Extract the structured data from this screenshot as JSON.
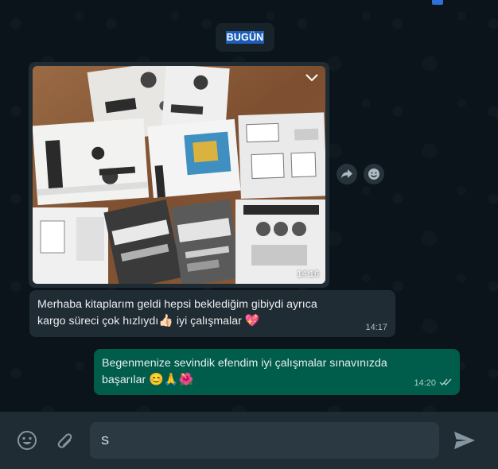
{
  "date_chip": "BUGÜN",
  "messages": [
    {
      "kind": "image",
      "direction": "incoming",
      "time": "14:16"
    },
    {
      "kind": "text",
      "direction": "incoming",
      "line1": "Merhaba kitaplarım geldi hepsi beklediğim gibiydi ayrıca",
      "line2_text": "kargo süreci çok hızlıydı",
      "line2_emoji": "👍🏻",
      "line2_after": " iyi çalışmalar ",
      "line2_emoji2": "💖",
      "time": "14:17"
    },
    {
      "kind": "text",
      "direction": "outgoing",
      "line1": "Begenmenize sevindik efendim iyi çalışmalar sınavınızda",
      "line2_text": "başarılar ",
      "line2_emoji": "😊🙏🌺",
      "time": "14:20",
      "status_icon": "double-check-icon"
    }
  ],
  "composer": {
    "value": "S"
  },
  "icons": {
    "image_menu": "chevron-down-icon",
    "forward": "forward-icon",
    "react": "emoji-react-icon",
    "emoji": "emoji-icon",
    "attach": "paperclip-icon",
    "send": "send-icon"
  },
  "colors": {
    "background": "#0b141a",
    "incoming_bubble": "#202c33",
    "outgoing_bubble": "#005c4b",
    "composer_bar": "#202c33",
    "input": "#2a3942",
    "date_highlight": "#1d5fb8"
  }
}
